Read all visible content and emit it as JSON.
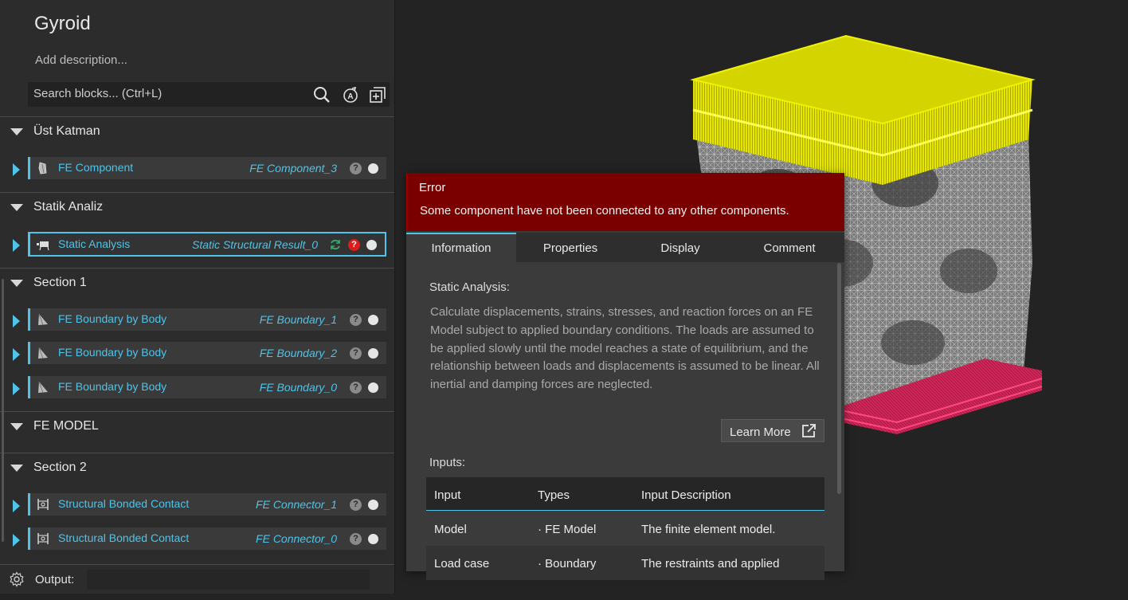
{
  "project": {
    "title": "Gyroid",
    "description_placeholder": "Add description..."
  },
  "search": {
    "placeholder": "Search blocks... (Ctrl+L)"
  },
  "sections": [
    {
      "name": "Üst Katman",
      "blocks": [
        {
          "name": "FE Component",
          "ref": "FE Component_3",
          "icon": "component-icon",
          "status": "help"
        }
      ]
    },
    {
      "name": "Statik Analiz",
      "blocks": [
        {
          "name": "Static Analysis",
          "ref": "Static Structural Result_0",
          "icon": "analysis-icon",
          "status": "error",
          "selected": true
        }
      ]
    },
    {
      "name": "Section 1",
      "blocks": [
        {
          "name": "FE Boundary by Body",
          "ref": "FE Boundary_1",
          "icon": "boundary-icon",
          "status": "help"
        },
        {
          "name": "FE Boundary by Body",
          "ref": "FE Boundary_2",
          "icon": "boundary-icon",
          "status": "help"
        },
        {
          "name": "FE Boundary by Body",
          "ref": "FE Boundary_0",
          "icon": "boundary-icon",
          "status": "help"
        }
      ]
    },
    {
      "name": "FE MODEL",
      "blocks": []
    },
    {
      "name": "Section 2",
      "blocks": [
        {
          "name": "Structural Bonded Contact",
          "ref": "FE Connector_1",
          "icon": "connector-icon",
          "status": "help"
        },
        {
          "name": "Structural Bonded Contact",
          "ref": "FE Connector_0",
          "icon": "connector-icon",
          "status": "help"
        }
      ]
    }
  ],
  "status_glyphs": {
    "help": "?"
  },
  "output": {
    "label": "Output:"
  },
  "popup": {
    "error_title": "Error",
    "error_message": "Some component have not been connected to any other components.",
    "tabs": [
      "Information",
      "Properties",
      "Display",
      "Comment"
    ],
    "active_tab": "Information",
    "heading": "Static Analysis:",
    "description": "Calculate displacements, strains, stresses, and reaction forces on an FE Model subject to applied boundary conditions. The loads are assumed to be applied slowly until the model reaches a state of equilibrium, and the relationship between loads and displacements is assumed to be linear. All inertial and damping forces are neglected.",
    "learn_more": "Learn More",
    "inputs_heading": "Inputs:",
    "inputs_columns": [
      "Input",
      "Types",
      "Input Description"
    ],
    "inputs_rows": [
      [
        "Model",
        "· FE Model",
        "The finite element model."
      ],
      [
        "Load case",
        "· Boundary",
        "The restraints and applied"
      ]
    ]
  },
  "colors": {
    "accent": "#4fc3e8",
    "error_bg": "#7a0000",
    "error_dot": "#e01b1b",
    "top_plate": "#f2f200",
    "bottom_plate": "#d6245a",
    "mesh": "#bdbdbd"
  }
}
